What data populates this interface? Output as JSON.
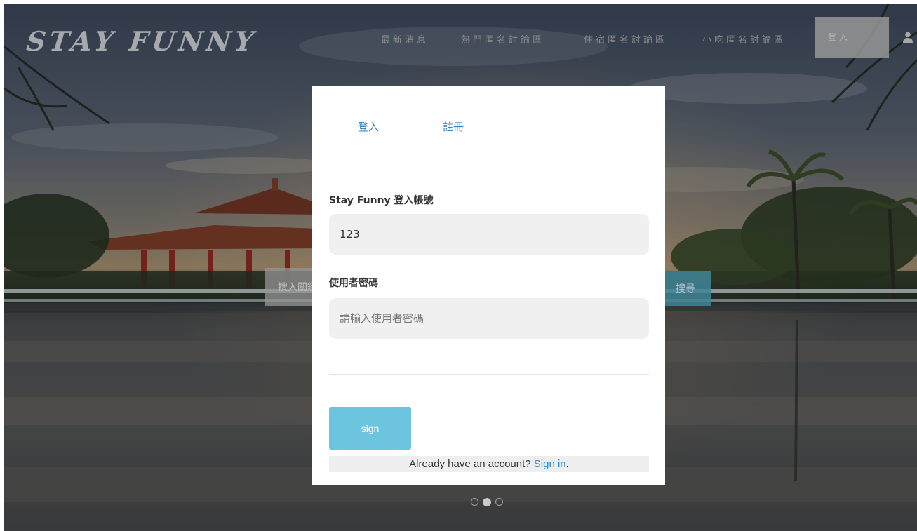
{
  "brand": {
    "name": "STAY FUNNY"
  },
  "nav": {
    "items": [
      {
        "label": "最新消息"
      },
      {
        "label": "熱門匿名討論區"
      },
      {
        "label": "住宿匿名討論區"
      },
      {
        "label": "小吃匿名討論區"
      }
    ],
    "button_label": "登入",
    "user_icon": "user-icon"
  },
  "hero": {
    "search_placeholder": "搜入關鍵字",
    "search_button": "搜尋",
    "carousel": {
      "total": 3,
      "active": 2
    }
  },
  "modal": {
    "tabs": [
      {
        "label": "登入"
      },
      {
        "label": "註冊"
      }
    ],
    "account_label": "Stay Funny 登入帳號",
    "account_value": "123",
    "password_label": "使用者密碼",
    "password_placeholder": "請輸入使用者密碼",
    "submit_label": "sign",
    "footer_text": "Already have an account? ",
    "footer_link": "Sign in",
    "footer_end": "."
  },
  "colors": {
    "tab_link": "#3a86c2",
    "submit_button": "#6cc4de",
    "footer_link": "#2a8ad8",
    "field_bg": "#f0f0f0"
  }
}
